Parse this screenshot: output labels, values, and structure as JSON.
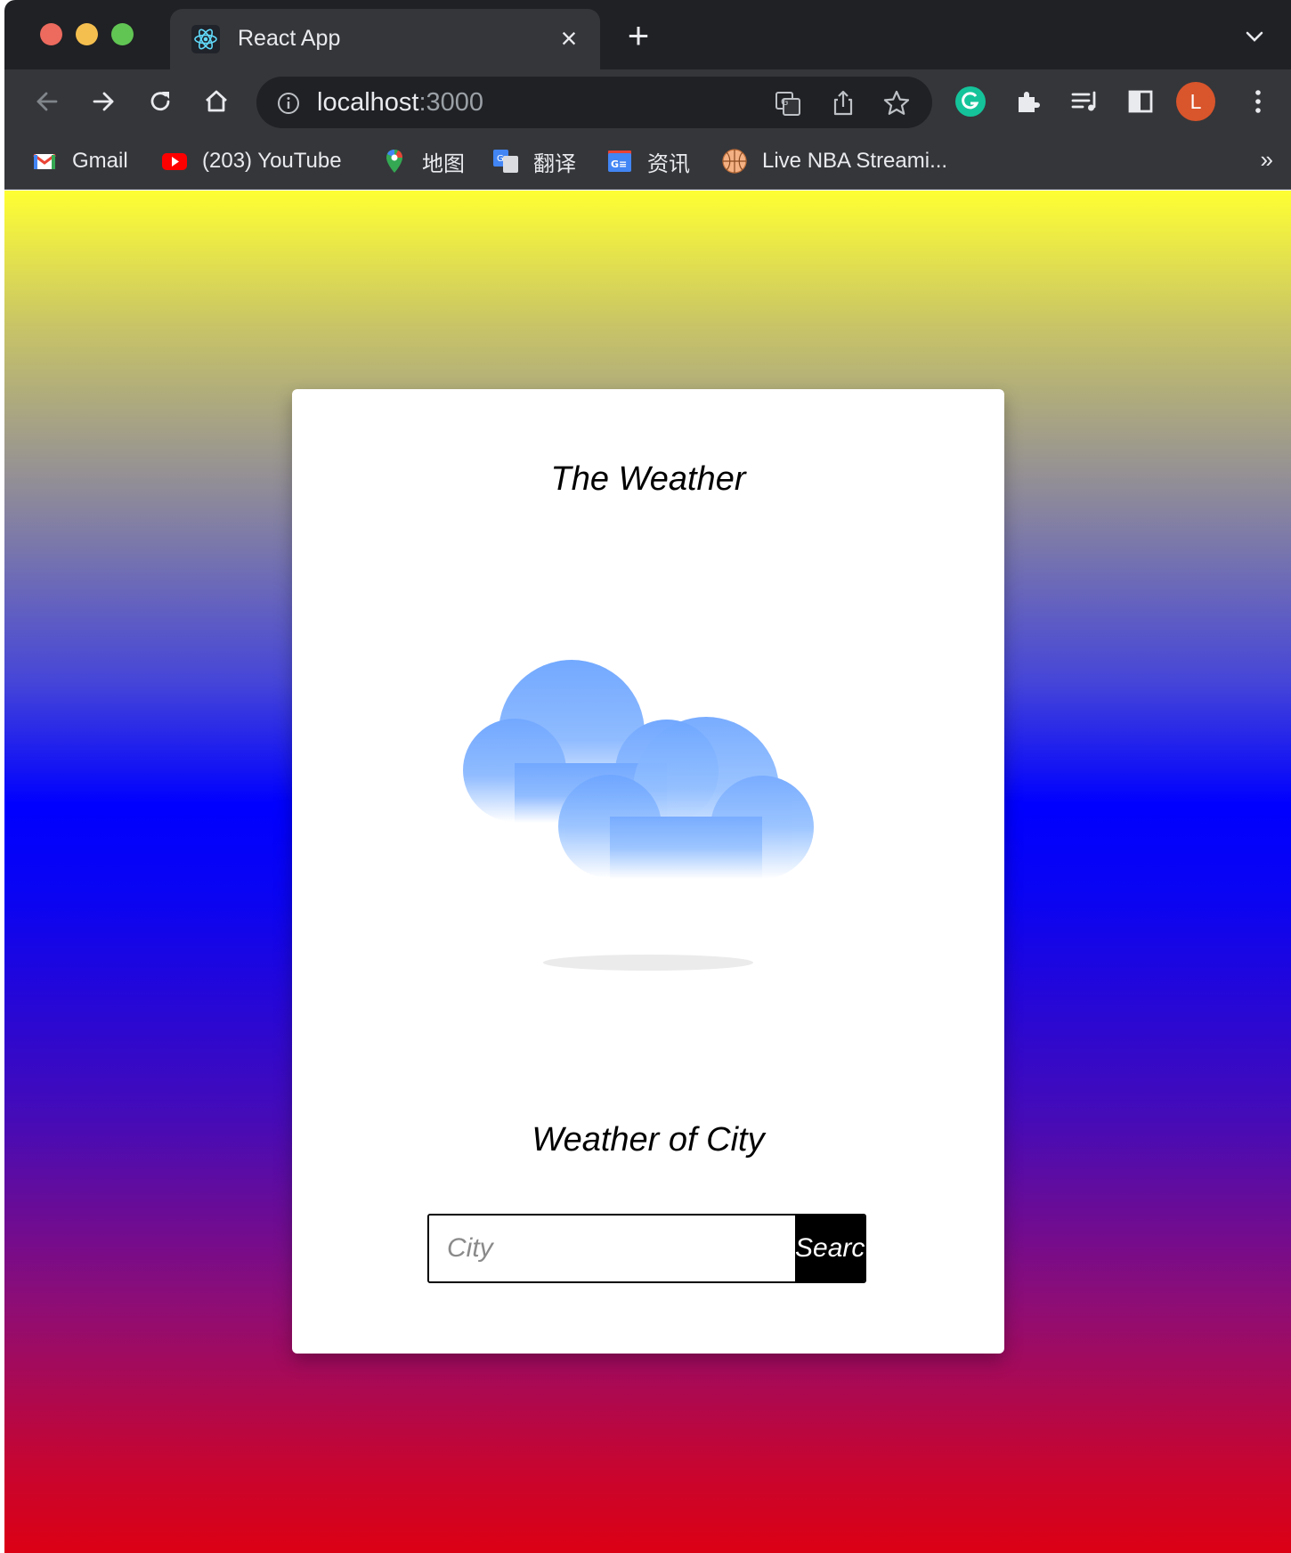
{
  "browser": {
    "tab": {
      "title": "React App",
      "icon": "react-icon"
    },
    "address": {
      "host": "localhost",
      "port": ":3000"
    },
    "profile_initial": "L",
    "bookmarks": [
      {
        "label": "Gmail",
        "icon": "gmail-icon"
      },
      {
        "label": "(203) YouTube",
        "icon": "youtube-icon"
      },
      {
        "label": "地图",
        "icon": "maps-pin-icon"
      },
      {
        "label": "翻译",
        "icon": "translate-icon"
      },
      {
        "label": "资讯",
        "icon": "news-icon"
      },
      {
        "label": "Live NBA Streami...",
        "icon": "basketball-icon"
      }
    ],
    "bookmarks_overflow": "»"
  },
  "app": {
    "title": "The Weather",
    "illustration": "clouds-icon",
    "subtitle": "Weather of City",
    "search": {
      "placeholder": "City",
      "value": "",
      "button_label": "Search"
    }
  },
  "colors": {
    "gradient_top": "#ffff33",
    "gradient_middle": "#0000ff",
    "gradient_bottom": "#dc0014",
    "cloud_blue": "#6ea6ff",
    "button": "#000000",
    "avatar": "#d9552b"
  }
}
